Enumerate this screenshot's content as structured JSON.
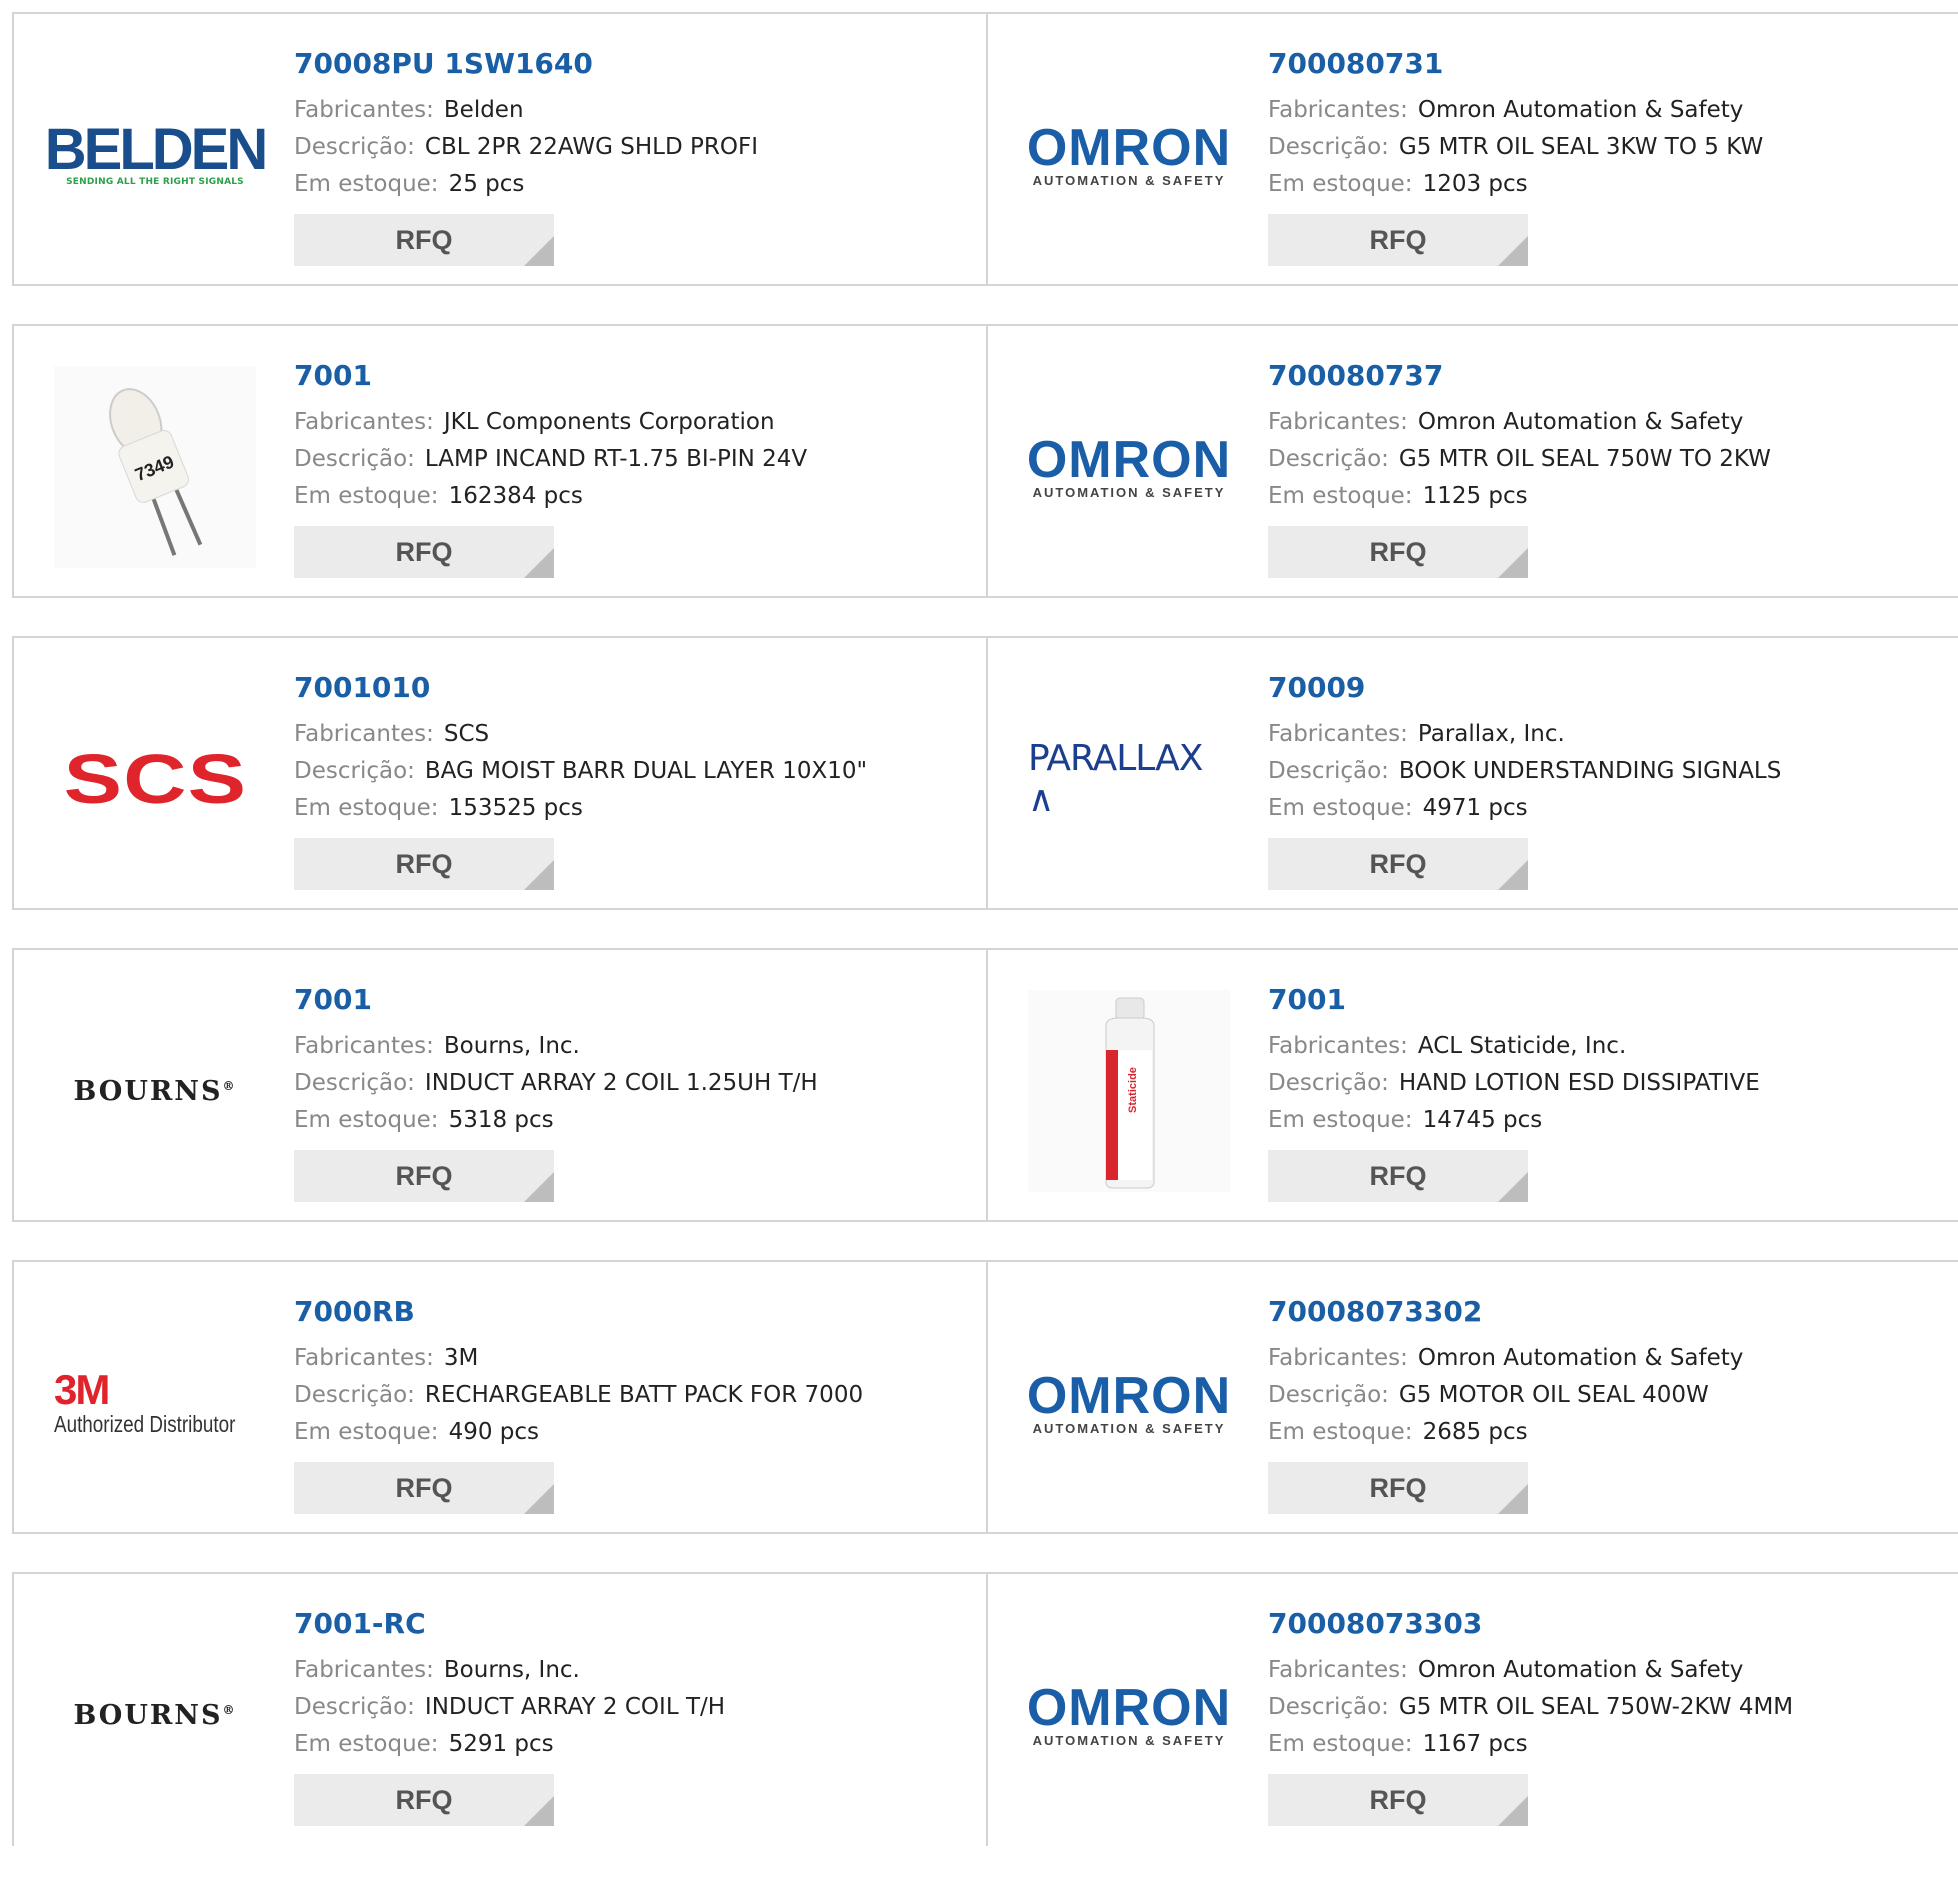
{
  "labels": {
    "manufacturer": "Fabricantes:",
    "description": "Descrição:",
    "stock": "Em estoque:",
    "rfq": "RFQ"
  },
  "logos": {
    "belden": {
      "word": "BELDEN",
      "tagline": "SENDING ALL THE RIGHT SIGNALS"
    },
    "omron": {
      "word": "OMRON",
      "tagline": "AUTOMATION & SAFETY"
    },
    "scs": {
      "word": "SCS"
    },
    "parallax": {
      "word": "PARALLAX ∧"
    },
    "bourns": {
      "word": "BOURNS",
      "mark": "®"
    },
    "3m": {
      "word": "3M",
      "tagline": "Authorized Distributor"
    }
  },
  "products": [
    {
      "part": "70008PU 1SW1640",
      "manufacturer": "Belden",
      "description": "CBL 2PR 22AWG SHLD PROFI",
      "stock": "25 pcs",
      "logo": "belden"
    },
    {
      "part": "700080731",
      "manufacturer": "Omron Automation & Safety",
      "description": "G5 MTR OIL SEAL 3KW TO 5 KW",
      "stock": "1203 pcs",
      "logo": "omron"
    },
    {
      "part": "7001",
      "manufacturer": "JKL Components Corporation",
      "description": "LAMP INCAND RT-1.75 BI-PIN 24V",
      "stock": "162384 pcs",
      "logo": "lamp",
      "lamp_label": "7349"
    },
    {
      "part": "700080737",
      "manufacturer": "Omron Automation & Safety",
      "description": "G5 MTR OIL SEAL 750W TO 2KW",
      "stock": "1125 pcs",
      "logo": "omron"
    },
    {
      "part": "7001010",
      "manufacturer": "SCS",
      "description": "BAG MOIST BARR DUAL LAYER 10X10\"",
      "stock": "153525 pcs",
      "logo": "scs"
    },
    {
      "part": "70009",
      "manufacturer": "Parallax, Inc.",
      "description": "BOOK UNDERSTANDING SIGNALS",
      "stock": "4971 pcs",
      "logo": "parallax"
    },
    {
      "part": "7001",
      "manufacturer": "Bourns, Inc.",
      "description": "INDUCT ARRAY 2 COIL 1.25UH T/H",
      "stock": "5318 pcs",
      "logo": "bourns"
    },
    {
      "part": "7001",
      "manufacturer": "ACL Staticide, Inc.",
      "description": "HAND LOTION ESD DISSIPATIVE",
      "stock": "14745 pcs",
      "logo": "bottle",
      "bottle_label": "Staticide"
    },
    {
      "part": "7000RB",
      "manufacturer": "3M",
      "description": "RECHARGEABLE BATT PACK FOR 7000",
      "stock": "490 pcs",
      "logo": "3m"
    },
    {
      "part": "70008073302",
      "manufacturer": "Omron Automation & Safety",
      "description": "G5 MOTOR OIL SEAL 400W",
      "stock": "2685 pcs",
      "logo": "omron"
    },
    {
      "part": "7001-RC",
      "manufacturer": "Bourns, Inc.",
      "description": "INDUCT ARRAY 2 COIL T/H",
      "stock": "5291 pcs",
      "logo": "bourns"
    },
    {
      "part": "70008073303",
      "manufacturer": "Omron Automation & Safety",
      "description": "G5 MTR OIL SEAL 750W-2KW 4MM",
      "stock": "1167 pcs",
      "logo": "omron"
    }
  ]
}
